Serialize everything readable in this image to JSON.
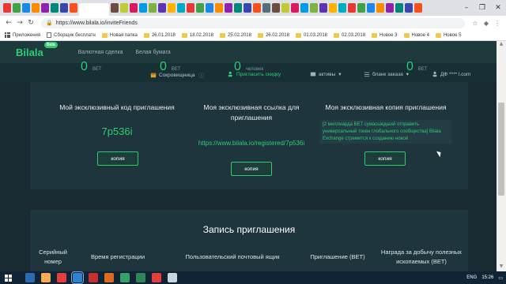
{
  "browser": {
    "url": "https://www.bilala.io/inviteFriends",
    "tab_colors": [
      "#e53935",
      "#43a047",
      "#1e88e5",
      "#fb8c00",
      "#8e24aa",
      "#00897b",
      "#3949ab",
      "#f4511e",
      "#546e7a",
      "#6d4c41",
      "#c0ca33",
      "#d81b60",
      "#039be5",
      "#7cb342",
      "#5e35b1",
      "#ffb300",
      "#00acc1",
      "#e53935",
      "#43a047",
      "#1e88e5",
      "#fb8c00",
      "#8e24aa",
      "#00897b",
      "#3949ab",
      "#f4511e",
      "#546e7a",
      "#6d4c41",
      "#c0ca33",
      "#d81b60",
      "#039be5",
      "#7cb342",
      "#5e35b1",
      "#ffb300",
      "#00acc1",
      "#e53935",
      "#43a047",
      "#1e88e5",
      "#fb8c00",
      "#8e24aa",
      "#00897b",
      "#3949ab",
      "#f4511e"
    ],
    "active_tab_index": 8,
    "bookmarks": [
      {
        "label": "Приложения",
        "icon": "apps-icon"
      },
      {
        "label": "Сборщик бесплатн",
        "icon": "page-icon"
      },
      {
        "label": "Новая папка",
        "icon": "folder-icon"
      },
      {
        "label": "26.01.2018",
        "icon": "folder-icon"
      },
      {
        "label": "18.02.2018",
        "icon": "folder-icon"
      },
      {
        "label": "25.02.2018",
        "icon": "folder-icon"
      },
      {
        "label": "26.02.2018",
        "icon": "folder-icon"
      },
      {
        "label": "01.03.2018",
        "icon": "folder-icon"
      },
      {
        "label": "02.03.2018",
        "icon": "folder-icon"
      },
      {
        "label": "Новое 3",
        "icon": "folder-icon"
      },
      {
        "label": "Новое 4",
        "icon": "folder-icon"
      },
      {
        "label": "Новое 5",
        "icon": "folder-icon"
      }
    ]
  },
  "site": {
    "logo": "Bilala",
    "badge": "Beta",
    "nav": [
      "Валютная сделка",
      "Белая бумага"
    ],
    "balances": [
      {
        "value": "0",
        "unit": "BET"
      },
      {
        "value": "0",
        "unit": "BET"
      },
      {
        "value": "0",
        "unit": "человек"
      },
      {
        "value": "0",
        "unit": "BET"
      }
    ],
    "subnav": {
      "treasury": "Сокровищница",
      "invite": "Пригласить скидку",
      "assets": "активы",
      "orders": "бланк заказа",
      "user": "ДФ **** l.com"
    }
  },
  "invite": {
    "code_title": "Мой эксклюзивный код приглашения",
    "code": "7p536i",
    "link_title": "Моя эксклюзивная ссылка для приглашения",
    "link": "https://www.bilala.io/registered/7p536i",
    "copy_title": "Моя эксклюзивная копия приглашения",
    "copy_text": "[2 миллиарда BET сумасшедший отправить универсальный токен глобального сообщества] Bilala Exchange стремится к созданию новой",
    "copy_button": "копия"
  },
  "history": {
    "title": "Запись приглашения",
    "columns": [
      "Серийный номер",
      "Время регистрации",
      "Пользовательский почтовый ящик",
      "Приглашение (BET)",
      "Награда за добычу полезных ископаемых (BET)"
    ]
  },
  "taskbar": {
    "apps": [
      "#2b6cb0",
      "#f6ad55",
      "#e53e3e",
      "#3182ce",
      "#c53030",
      "#dd6b20",
      "#38a169",
      "#2f855a",
      "#e53e3e",
      "#cbd5e0"
    ],
    "lang": "ENG",
    "time": "15:26"
  },
  "colors": {
    "accent": "#2ecc71",
    "header_bg": "#1e3a3d",
    "card_bg": "#1f353e"
  }
}
